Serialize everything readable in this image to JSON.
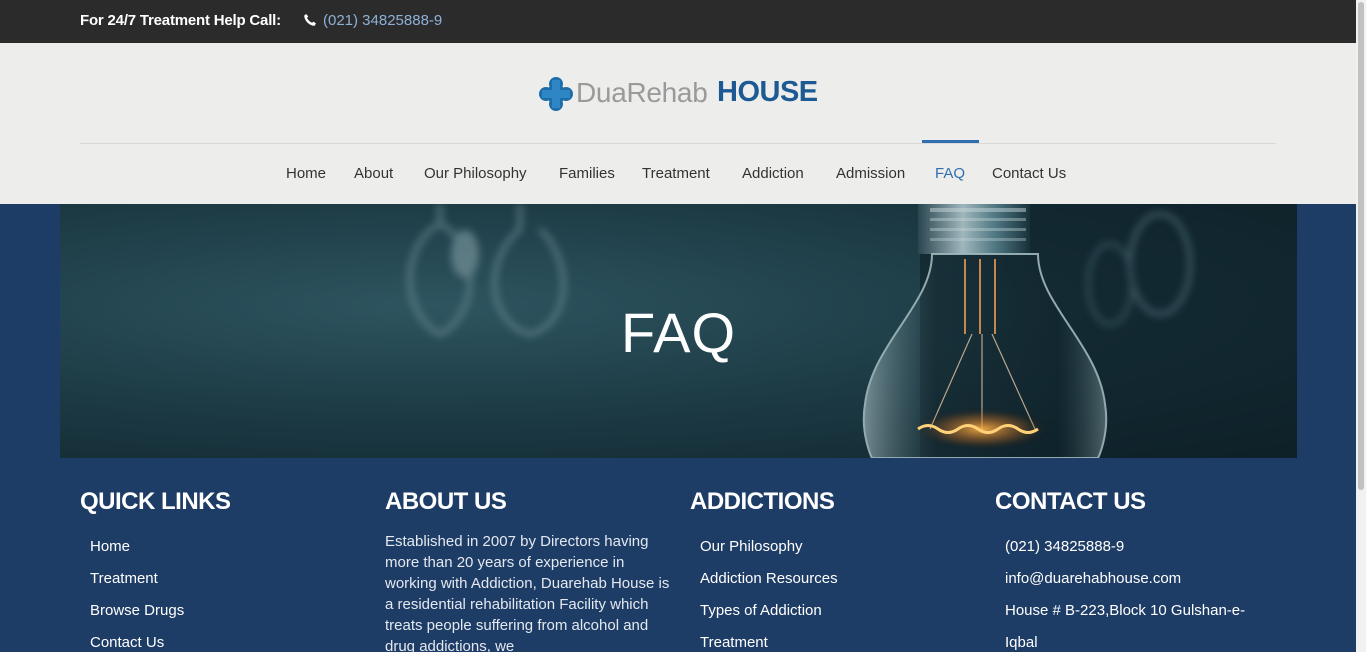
{
  "topbar": {
    "help_text": "For 24/7 Treatment Help Call:",
    "phone": "(021) 34825888-9",
    "phone_icon": "phone-icon"
  },
  "logo": {
    "part1": "DuaRehab",
    "part2": "HOUSE",
    "icon": "medical-cross-icon"
  },
  "nav": {
    "items": [
      {
        "label": "Home"
      },
      {
        "label": "About"
      },
      {
        "label": "Our Philosophy"
      },
      {
        "label": "Families"
      },
      {
        "label": "Treatment"
      },
      {
        "label": "Addiction"
      },
      {
        "label": "Admission"
      },
      {
        "label": "FAQ",
        "active": true
      },
      {
        "label": "Contact Us"
      }
    ]
  },
  "hero": {
    "title": "FAQ"
  },
  "footer": {
    "quick_links": {
      "heading": "QUICK LINKS",
      "items": [
        "Home",
        "Treatment",
        "Browse Drugs",
        "Contact Us"
      ]
    },
    "about": {
      "heading": "ABOUT US",
      "text": "Established in 2007 by Directors having more than 20 years of experience in working with Addiction, Duarehab House is a residential rehabilitation Facility which treats people suffering from alcohol and drug addictions, we"
    },
    "addictions": {
      "heading": "ADDICTIONS",
      "items": [
        "Our Philosophy",
        "Addiction Resources",
        "Types of Addiction",
        "Treatment"
      ]
    },
    "contact": {
      "heading": "CONTACT US",
      "phone": "(021) 34825888-9",
      "email": "info@duarehabhouse.com",
      "address_line1": "House # B-223,Block 10 Gulshan-e-",
      "address_line2": "Iqbal"
    }
  },
  "colors": {
    "topbar_bg": "#2b2b2b",
    "header_bg": "#ededeb",
    "accent": "#2f6fb0",
    "footer_bg": "#1e3d66",
    "logo_blue": "#1d5a93"
  }
}
